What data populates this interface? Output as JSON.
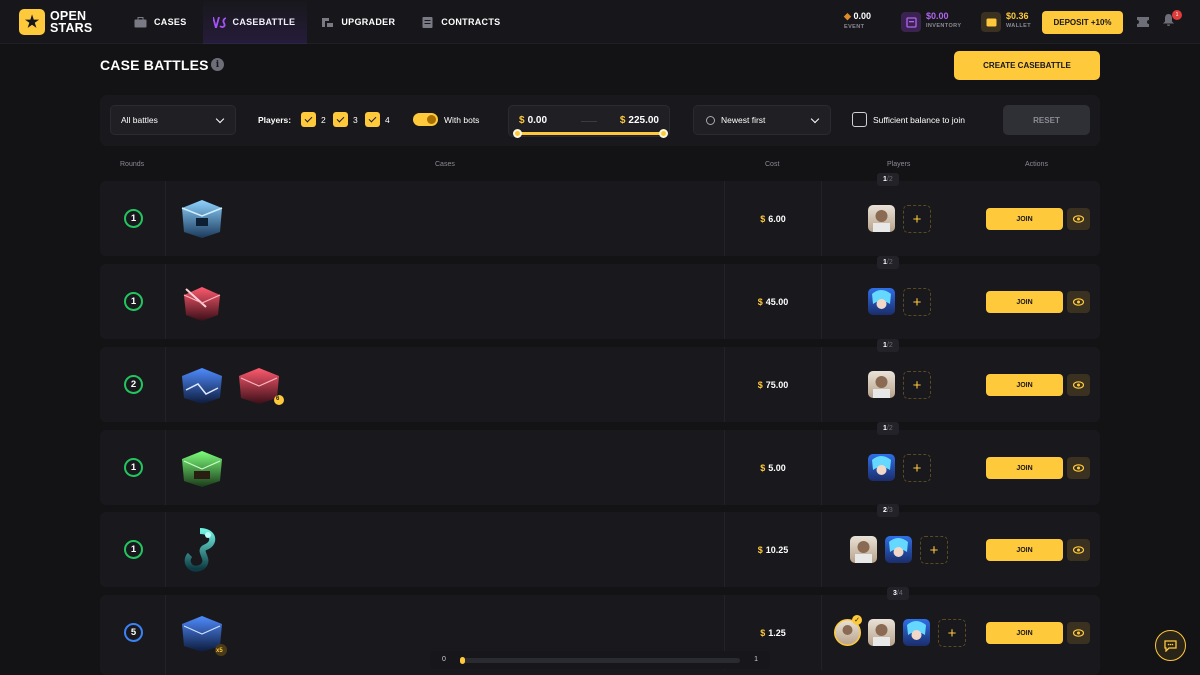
{
  "brand": {
    "line1": "OPEN",
    "line2": "STARS"
  },
  "nav": [
    {
      "label": "CASES",
      "icon": "case-icon"
    },
    {
      "label": "CASEBATTLE",
      "icon": "versus-icon"
    },
    {
      "label": "UPGRADER",
      "icon": "upgrader-icon"
    },
    {
      "label": "CONTRACTS",
      "icon": "contracts-icon"
    }
  ],
  "header": {
    "event_value": "0.00",
    "event_label": "EVENT",
    "inventory_value": "$0.00",
    "inventory_label": "INVENTORY",
    "wallet_value": "$0.36",
    "wallet_label": "WALLET",
    "deposit_label": "DEPOSIT +10%",
    "notification_count": "1"
  },
  "page": {
    "title": "CASE BATTLES",
    "create_label": "CREATE CASEBATTLE"
  },
  "filters": {
    "battle_type": "All battles",
    "players_label": "Players:",
    "player_options": [
      "2",
      "3",
      "4"
    ],
    "bots_label": "With bots",
    "price_min": "0.00",
    "price_max": "225.00",
    "currency": "$",
    "sort": "Newest first",
    "sufficient_label": "Sufficient balance to join",
    "reset_label": "RESET"
  },
  "table": {
    "headers": {
      "rounds": "Rounds",
      "cases": "Cases",
      "cost": "Cost",
      "players": "Players",
      "actions": "Actions"
    },
    "join_label": "JOIN",
    "rows": [
      {
        "rounds": "1",
        "cost": "6.00",
        "joined": "1",
        "total": "2"
      },
      {
        "rounds": "1",
        "cost": "45.00",
        "joined": "1",
        "total": "2"
      },
      {
        "rounds": "2",
        "cost": "75.00",
        "joined": "1",
        "total": "2"
      },
      {
        "rounds": "1",
        "cost": "5.00",
        "joined": "1",
        "total": "2"
      },
      {
        "rounds": "1",
        "cost": "10.25",
        "joined": "2",
        "total": "3"
      },
      {
        "rounds": "5",
        "cost": "1.25",
        "joined": "3",
        "total": "4"
      }
    ],
    "case_badges": {
      "row3_case2": "6",
      "row6_case1": "x5"
    }
  },
  "pager": {
    "min": "0",
    "max": "1"
  },
  "colors": {
    "accent": "#ffc93c",
    "round_green": "#22c55e",
    "round_blue": "#3b82f6",
    "background": "#131316"
  }
}
